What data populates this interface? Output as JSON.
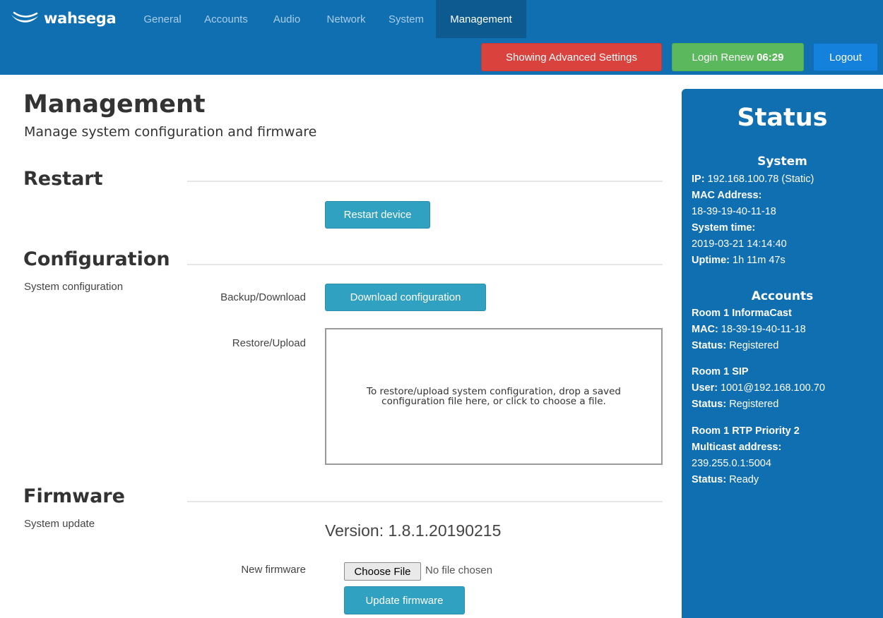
{
  "brand": {
    "name": "wahsega"
  },
  "nav": {
    "tabs": [
      "General",
      "Accounts",
      "Audio",
      "Network",
      "System",
      "Management"
    ],
    "active_tab": "Management"
  },
  "header_buttons": {
    "advanced": "Showing Advanced Settings",
    "renew_label": "Login Renew",
    "renew_time": "06:29",
    "logout": "Logout"
  },
  "page": {
    "title": "Management",
    "subtitle": "Manage system configuration and firmware"
  },
  "restart": {
    "title": "Restart",
    "button": "Restart device"
  },
  "configuration": {
    "title": "Configuration",
    "description": "System configuration",
    "backup_label": "Backup/Download",
    "backup_button": "Download configuration",
    "restore_label": "Restore/Upload",
    "dropzone_text": "To restore/upload system configuration, drop a saved configuration file here, or click to choose a file."
  },
  "firmware": {
    "title": "Firmware",
    "description": "System update",
    "version": "Version: 1.8.1.20190215",
    "new_label": "New firmware",
    "choose_button": "Choose File",
    "no_file": "No file chosen",
    "update_button": "Update firmware"
  },
  "status": {
    "title": "Status",
    "system": {
      "heading": "System",
      "ip_label": "IP:",
      "ip": "192.168.100.78 (Static)",
      "mac_label": "MAC Address:",
      "mac": "18-39-19-40-11-18",
      "time_label": "System time:",
      "time": "2019-03-21 14:14:40",
      "uptime_label": "Uptime:",
      "uptime": "1h 11m 47s"
    },
    "accounts": {
      "heading": "Accounts",
      "a1_name": "Room 1 InformaCast",
      "a1_mac_label": "MAC:",
      "a1_mac": "18-39-19-40-11-18",
      "a1_status_label": "Status:",
      "a1_status": "Registered",
      "a2_name": "Room 1 SIP",
      "a2_user_label": "User:",
      "a2_user": "1001@192.168.100.70",
      "a2_status_label": "Status:",
      "a2_status": "Registered",
      "a3_name": "Room 1 RTP Priority 2",
      "a3_mc_label": "Multicast address:",
      "a3_mc": "239.255.0.1:5004",
      "a3_status_label": "Status:",
      "a3_status": "Ready"
    }
  },
  "colors": {
    "navbar": "#106fb1",
    "active_tab": "#0c5a90",
    "danger": "#d9423d",
    "success": "#5cb85c",
    "primary": "#1481dc",
    "info": "#31a1c2"
  },
  "icons": {
    "brand_logo": "wave-logo-icon"
  }
}
